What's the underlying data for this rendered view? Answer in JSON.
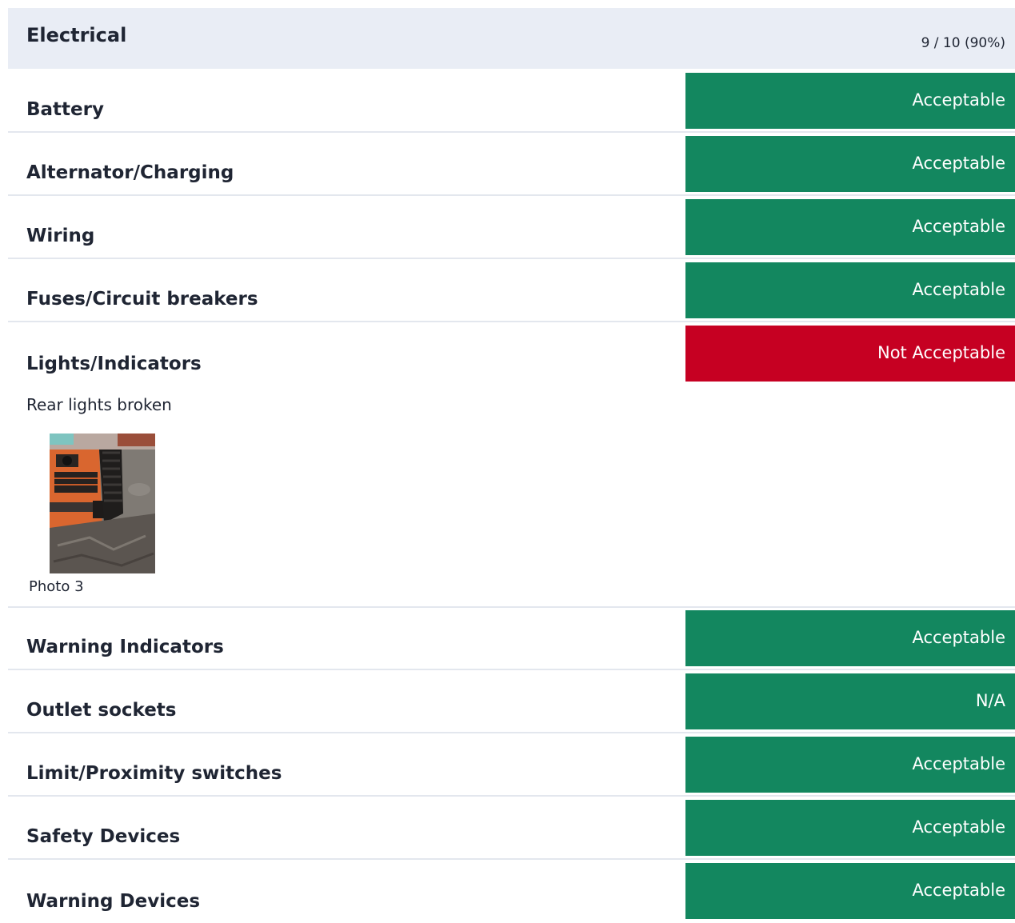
{
  "section": {
    "title": "Electrical",
    "score": "9 / 10 (90%)"
  },
  "items": [
    {
      "label": "Battery",
      "status": "Acceptable",
      "status_color": "#13875f"
    },
    {
      "label": "Alternator/Charging",
      "status": "Acceptable",
      "status_color": "#13875f"
    },
    {
      "label": "Wiring",
      "status": "Acceptable",
      "status_color": "#13875f"
    },
    {
      "label": "Fuses/Circuit breakers",
      "status": "Acceptable",
      "status_color": "#13875f"
    },
    {
      "label": "Lights/Indicators",
      "status": "Not Acceptable",
      "status_color": "#c60022",
      "note": "Rear lights broken",
      "photo_caption": "Photo 3"
    },
    {
      "label": "Warning Indicators",
      "status": "Acceptable",
      "status_color": "#13875f"
    },
    {
      "label": "Outlet sockets",
      "status": "N/A",
      "status_color": "#13875f"
    },
    {
      "label": "Limit/Proximity switches",
      "status": "Acceptable",
      "status_color": "#13875f"
    },
    {
      "label": "Safety Devices",
      "status": "Acceptable",
      "status_color": "#13875f"
    },
    {
      "label": "Warning Devices",
      "status": "Acceptable",
      "status_color": "#13875f"
    }
  ]
}
